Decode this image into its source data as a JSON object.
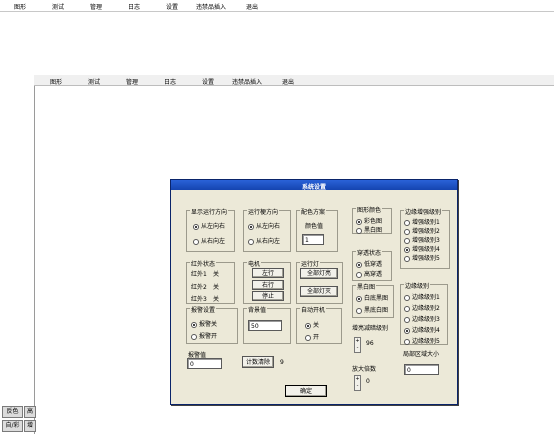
{
  "top_menu": [
    "图形",
    "测试",
    "管理",
    "日志",
    "设置",
    "违禁品插入",
    "退出"
  ],
  "inner_menu": [
    "图形",
    "测试",
    "管理",
    "日志",
    "设置",
    "违禁品插入",
    "退出"
  ],
  "side_buttons": [
    {
      "label": "反色"
    },
    {
      "label": "高"
    },
    {
      "label": "自/彩"
    },
    {
      "label": "增"
    }
  ],
  "dialog": {
    "title": "系统设置",
    "display_direction": {
      "title": "显示运行方向",
      "options": [
        {
          "label": "从左向右",
          "checked": true
        },
        {
          "label": "从右向左",
          "checked": false
        }
      ]
    },
    "belt_direction": {
      "title": "运行梗方向",
      "options": [
        {
          "label": "从左向右",
          "checked": true
        },
        {
          "label": "从右向左",
          "checked": false
        }
      ]
    },
    "color_scheme": {
      "title": "配色方案",
      "label": "颜色值",
      "value": "1"
    },
    "image_color": {
      "title": "图形颜色",
      "options": [
        {
          "label": "彩色图",
          "checked": true
        },
        {
          "label": "黑白图",
          "checked": false
        }
      ]
    },
    "edge_enhance": {
      "title": "边缘增强级别",
      "options": [
        {
          "label": "增强级别1",
          "checked": false
        },
        {
          "label": "增强级别2",
          "checked": false
        },
        {
          "label": "增强级别3",
          "checked": false
        },
        {
          "label": "增强级别4",
          "checked": true
        },
        {
          "label": "增强级别5",
          "checked": false
        }
      ]
    },
    "infrared": {
      "title": "红外状态",
      "items": [
        {
          "name": "红外1",
          "state": "关"
        },
        {
          "name": "红外2",
          "state": "关"
        },
        {
          "name": "红外3",
          "state": "关"
        }
      ]
    },
    "motor": {
      "title": "电机",
      "buttons": [
        "左行",
        "右行",
        "停止"
      ]
    },
    "run_light": {
      "title": "运行灯",
      "buttons": [
        "全部灯亮",
        "全部灯灭"
      ]
    },
    "penetration": {
      "title": "穿透状态",
      "options": [
        {
          "label": "低穿透",
          "checked": true
        },
        {
          "label": "高穿透",
          "checked": false
        }
      ]
    },
    "bw_image": {
      "title": "黑白图",
      "options": [
        {
          "label": "白底黑图",
          "checked": true
        },
        {
          "label": "黑底白图",
          "checked": false
        }
      ]
    },
    "edge_level": {
      "title": "边缘级别",
      "options": [
        {
          "label": "边缘级别1",
          "checked": false
        },
        {
          "label": "边缘级别2",
          "checked": false
        },
        {
          "label": "边缘级别3",
          "checked": false
        },
        {
          "label": "边缘级别4",
          "checked": true
        },
        {
          "label": "边缘级别5",
          "checked": false
        }
      ]
    },
    "alarm_setting": {
      "title": "报警设置",
      "options": [
        {
          "label": "报警关",
          "checked": true
        },
        {
          "label": "报警开",
          "checked": false
        }
      ]
    },
    "background": {
      "title": "背景值",
      "value": "50"
    },
    "auto_power": {
      "title": "自动开机",
      "options": [
        {
          "label": "关",
          "checked": true
        },
        {
          "label": "开",
          "checked": false
        }
      ]
    },
    "brightness": {
      "title": "增亮减暗级别",
      "value": "96"
    },
    "alarm_value": {
      "title": "报警值",
      "value": "0"
    },
    "count_clear": {
      "label": "计数清除",
      "count": "9"
    },
    "zoom": {
      "title": "放大倍数",
      "value": "0"
    },
    "local_area": {
      "title": "局部区域大小",
      "value": "0"
    },
    "ok_label": "确定"
  }
}
